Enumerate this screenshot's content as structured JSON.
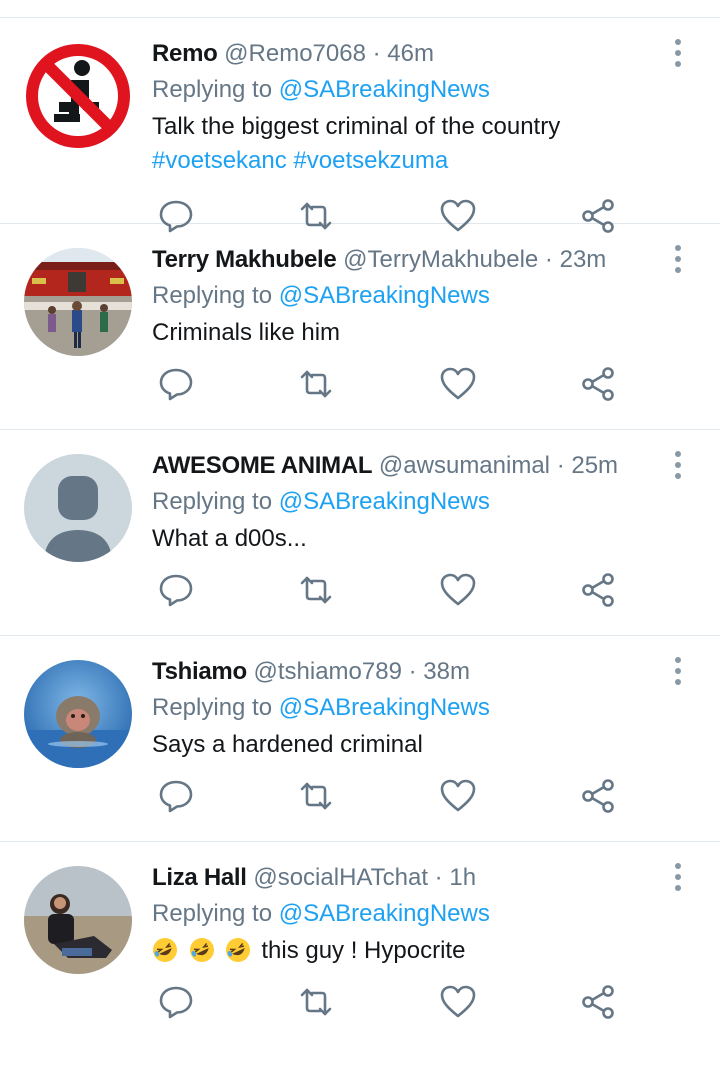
{
  "replying_prefix": "Replying to",
  "replying_to": "@SABreakingNews",
  "colors": {
    "link": "#1da1f2",
    "secondary": "#657786",
    "divider": "#e1e8ed"
  },
  "tweets": [
    {
      "name": "Remo",
      "handle": "@Remo7068",
      "separator": "·",
      "time": "46m",
      "text": "Talk the biggest criminal of the country",
      "hashtags": "#voetsekanc #voetsekzuma",
      "avatar_icon": "no-kneeling-sign-icon"
    },
    {
      "name": "Terry Makhubele",
      "handle": "@TerryMakhubele",
      "separator": "·",
      "time": "23m",
      "text": "Criminals like him",
      "avatar_icon": "square-photo-avatar"
    },
    {
      "name": "AWESOME ANIMAL",
      "handle": "@awsumanimal",
      "separator": "·",
      "time": "25m",
      "text": "What a d00s...",
      "avatar_icon": "default-profile-icon"
    },
    {
      "name": "Tshiamo",
      "handle": "@tshiamo789",
      "separator": "·",
      "time": "38m",
      "text": "Says a hardened criminal",
      "avatar_icon": "monkey-photo-avatar"
    },
    {
      "name": "Liza Hall",
      "handle": "@socialHATchat",
      "separator": "·",
      "time": "1h",
      "text": "this guy ! Hypocrite",
      "emoji": "rolling-on-floor-laughing x3",
      "avatar_icon": "person-photo-avatar"
    }
  ]
}
